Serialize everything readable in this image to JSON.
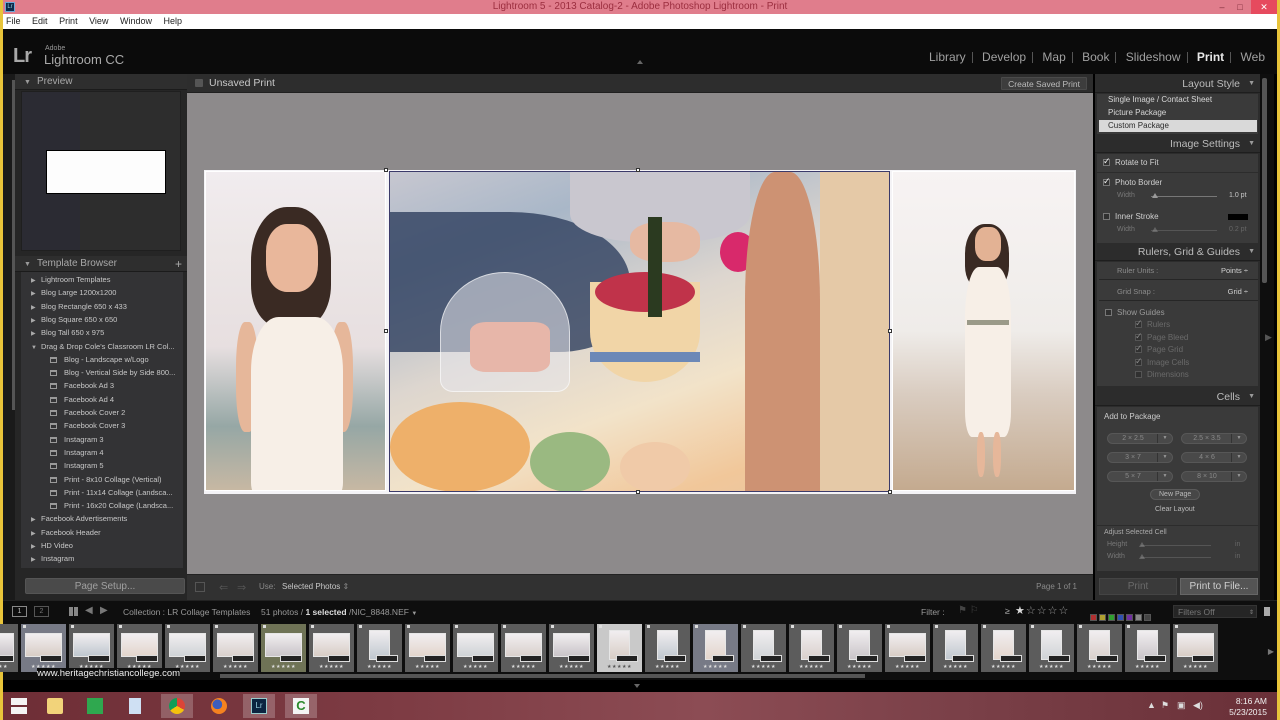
{
  "window": {
    "title": "Lightroom 5 - 2013 Catalog-2 - Adobe Photoshop Lightroom - Print",
    "app_icon_label": "Lr",
    "controls": {
      "minimize": "–",
      "maximize": "□",
      "close": "✕"
    }
  },
  "menu": [
    "File",
    "Edit",
    "Print",
    "View",
    "Window",
    "Help"
  ],
  "branding": {
    "mark": "Lr",
    "vendor": "Adobe",
    "product": "Lightroom CC"
  },
  "modules": [
    {
      "label": "Library",
      "active": false
    },
    {
      "label": "Develop",
      "active": false
    },
    {
      "label": "Map",
      "active": false
    },
    {
      "label": "Book",
      "active": false
    },
    {
      "label": "Slideshow",
      "active": false
    },
    {
      "label": "Print",
      "active": true
    },
    {
      "label": "Web",
      "active": false
    }
  ],
  "left_panel": {
    "preview_title": "Preview",
    "template_browser_title": "Template Browser",
    "add_icon": "+",
    "templates": [
      {
        "label": "Lightroom Templates",
        "type": "folder",
        "expanded": false
      },
      {
        "label": "Blog Large 1200x1200",
        "type": "folder",
        "expanded": false
      },
      {
        "label": "Blog Rectangle 650 x 433",
        "type": "folder",
        "expanded": false
      },
      {
        "label": "Blog Square 650 x 650",
        "type": "folder",
        "expanded": false
      },
      {
        "label": "Blog Tall 650 x 975",
        "type": "folder",
        "expanded": false
      },
      {
        "label": "Drag & Drop Cole's Classroom LR Col...",
        "type": "folder",
        "expanded": true
      },
      {
        "label": "Blog - Landscape w/Logo",
        "type": "template"
      },
      {
        "label": "Blog - Vertical Side by Side 800...",
        "type": "template"
      },
      {
        "label": "Facebook Ad 3",
        "type": "template"
      },
      {
        "label": "Facebook Ad 4",
        "type": "template"
      },
      {
        "label": "Facebook Cover 2",
        "type": "template"
      },
      {
        "label": "Facebook Cover 3",
        "type": "template"
      },
      {
        "label": "Instagram 3",
        "type": "template"
      },
      {
        "label": "Instagram 4",
        "type": "template"
      },
      {
        "label": "Instagram 5",
        "type": "template"
      },
      {
        "label": "Print - 8x10 Collage (Vertical)",
        "type": "template"
      },
      {
        "label": "Print - 11x14 Collage (Landsca...",
        "type": "template"
      },
      {
        "label": "Print - 16x20 Collage (Landsca...",
        "type": "template"
      },
      {
        "label": "Facebook Advertisements",
        "type": "folder",
        "expanded": false
      },
      {
        "label": "Facebook Header",
        "type": "folder",
        "expanded": false
      },
      {
        "label": "HD Video",
        "type": "folder",
        "expanded": false
      },
      {
        "label": "Instagram",
        "type": "folder",
        "expanded": false
      }
    ],
    "page_setup_label": "Page Setup..."
  },
  "center": {
    "title": "Unsaved Print",
    "create_saved_print_label": "Create Saved Print",
    "cells": [
      {
        "subject": "woman in white dress smiling, portrait"
      },
      {
        "subject": "picnic table with cake dome, strawberries and flowers"
      },
      {
        "subject": "woman in white dress laughing on beach"
      }
    ],
    "toolbar": {
      "use_label": "Use:",
      "use_value": "Selected Photos",
      "use_arrows": "⇕",
      "page_info": "Page 1 of 1"
    }
  },
  "right_panel": {
    "layout_style": {
      "title": "Layout Style",
      "options": [
        {
          "label": "Single Image / Contact Sheet",
          "selected": false
        },
        {
          "label": "Picture Package",
          "selected": false
        },
        {
          "label": "Custom Package",
          "selected": true
        }
      ]
    },
    "image_settings": {
      "title": "Image Settings",
      "rotate_to_fit": {
        "label": "Rotate to Fit",
        "checked": true
      },
      "photo_border": {
        "label": "Photo Border",
        "checked": true,
        "width_label": "Width",
        "width_value": "1.0 pt",
        "width_fraction": 0.05
      },
      "inner_stroke": {
        "label": "Inner Stroke",
        "checked": false,
        "width_label": "Width",
        "width_value": "0.2 pt",
        "color": "#000000",
        "width_fraction": 0.05
      }
    },
    "rulers": {
      "title": "Rulers, Grid & Guides",
      "ruler_units_label": "Ruler Units :",
      "ruler_units_value": "Points ÷",
      "grid_snap_label": "Grid Snap :",
      "grid_snap_value": "Grid ÷",
      "show_guides": {
        "label": "Show Guides",
        "checked": false
      },
      "guides": [
        {
          "label": "Rulers",
          "checked": true
        },
        {
          "label": "Page Bleed",
          "checked": true
        },
        {
          "label": "Page Grid",
          "checked": true
        },
        {
          "label": "Image Cells",
          "checked": true
        },
        {
          "label": "Dimensions",
          "checked": false
        }
      ]
    },
    "cells": {
      "title": "Cells",
      "add_to_package_label": "Add to Package",
      "sizes": [
        "2 × 2.5",
        "2.5 × 3.5",
        "3 × 7",
        "4 × 6",
        "5 × 7",
        "8 × 10"
      ],
      "new_page_label": "New Page",
      "clear_layout_label": "Clear Layout",
      "adjust_selected_cell_label": "Adjust Selected Cell",
      "height_label": "Height",
      "height_value": "in",
      "width_label": "Width",
      "width_value": "in"
    },
    "print_label": "Print",
    "print_to_file_label": "Print to File..."
  },
  "filmstrip_bar": {
    "view1": "1",
    "view2": "2",
    "collection": "Collection : LR Collage Templates",
    "count_prefix": "51 photos /",
    "selected": "1 selected",
    "filename": "/NIC_8848.NEF",
    "filter_label": "Filter :",
    "gte": "≥",
    "rating_stars": 1,
    "filters_value": "Filters Off",
    "label_colors": [
      "#b03030",
      "#b0a030",
      "#30a030",
      "#3050b0",
      "#7030a0",
      "#888888",
      "#444444"
    ]
  },
  "filmstrip": {
    "thumb_count": 26,
    "selected_index": 13,
    "rating_glyph": "★★★★★"
  },
  "watermark": "www.heritagechristiancollege.com",
  "taskbar": {
    "apps": [
      "windows-start",
      "file-explorer",
      "store",
      "notepad",
      "chrome",
      "firefox",
      "lightroom",
      "camtasia"
    ],
    "time": "8:16 AM",
    "date": "5/23/2015"
  }
}
